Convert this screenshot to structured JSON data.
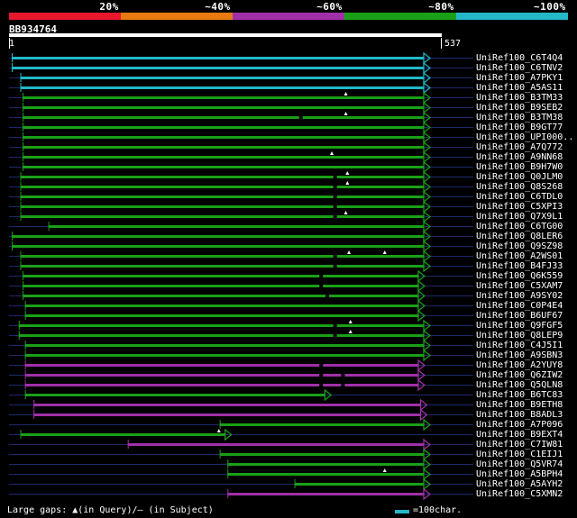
{
  "legend": {
    "colors": [
      "#e8182e",
      "#e87a12",
      "#a030a8",
      "#1aa018",
      "#22b8c8"
    ],
    "labels": [
      "20%",
      "~40%",
      "~60%",
      "~80%",
      "~100%"
    ]
  },
  "query": {
    "title": "BB934764",
    "start": "1",
    "end": "537"
  },
  "hits": [
    {
      "name": "UniRef100_C6T4Q4",
      "color": "#22b8c8",
      "start": 1,
      "end": 537,
      "gaps_q": [],
      "gaps_s": []
    },
    {
      "name": "UniRef100_C6TNV2",
      "color": "#22b8c8",
      "start": 1,
      "end": 537,
      "gaps_q": [],
      "gaps_s": []
    },
    {
      "name": "UniRef100_A7PKY1",
      "color": "#22b8c8",
      "start": 12,
      "end": 537,
      "gaps_q": [],
      "gaps_s": []
    },
    {
      "name": "UniRef100_A5AS11",
      "color": "#22b8c8",
      "start": 12,
      "end": 537,
      "gaps_q": [],
      "gaps_s": []
    },
    {
      "name": "UniRef100_B3TM33",
      "color": "#1aa018",
      "start": 15,
      "end": 537,
      "gaps_q": [
        430
      ],
      "gaps_s": []
    },
    {
      "name": "UniRef100_B9SEB2",
      "color": "#1aa018",
      "start": 15,
      "end": 537,
      "gaps_q": [],
      "gaps_s": []
    },
    {
      "name": "UniRef100_B3TM38",
      "color": "#1aa018",
      "start": 15,
      "end": 537,
      "gaps_q": [
        430
      ],
      "gaps_s": [
        370
      ]
    },
    {
      "name": "UniRef100_B9GT77",
      "color": "#1aa018",
      "start": 15,
      "end": 537,
      "gaps_q": [],
      "gaps_s": []
    },
    {
      "name": "UniRef100_UPI000..",
      "color": "#1aa018",
      "start": 15,
      "end": 537,
      "gaps_q": [],
      "gaps_s": []
    },
    {
      "name": "UniRef100_A7Q772",
      "color": "#1aa018",
      "start": 15,
      "end": 537,
      "gaps_q": [],
      "gaps_s": []
    },
    {
      "name": "UniRef100_A9NN68",
      "color": "#1aa018",
      "start": 15,
      "end": 537,
      "gaps_q": [
        412
      ],
      "gaps_s": []
    },
    {
      "name": "UniRef100_B9H7W0",
      "color": "#1aa018",
      "start": 15,
      "end": 537,
      "gaps_q": [],
      "gaps_s": []
    },
    {
      "name": "UniRef100_Q0JLM0",
      "color": "#1aa018",
      "start": 12,
      "end": 537,
      "gaps_q": [
        432
      ],
      "gaps_s": [
        414
      ]
    },
    {
      "name": "UniRef100_Q8S268",
      "color": "#1aa018",
      "start": 12,
      "end": 537,
      "gaps_q": [
        432
      ],
      "gaps_s": [
        414
      ]
    },
    {
      "name": "UniRef100_C6TDL0",
      "color": "#1aa018",
      "start": 12,
      "end": 537,
      "gaps_q": [],
      "gaps_s": [
        414
      ]
    },
    {
      "name": "UniRef100_C5XPI3",
      "color": "#1aa018",
      "start": 12,
      "end": 537,
      "gaps_q": [],
      "gaps_s": [
        414
      ]
    },
    {
      "name": "UniRef100_Q7X9L1",
      "color": "#1aa018",
      "start": 12,
      "end": 537,
      "gaps_q": [
        430
      ],
      "gaps_s": [
        414
      ]
    },
    {
      "name": "UniRef100_C6TG00",
      "color": "#1aa018",
      "start": 48,
      "end": 537,
      "gaps_q": [],
      "gaps_s": []
    },
    {
      "name": "UniRef100_Q8LER6",
      "color": "#1aa018",
      "start": 1,
      "end": 537,
      "gaps_q": [],
      "gaps_s": []
    },
    {
      "name": "UniRef100_Q9SZ98",
      "color": "#1aa018",
      "start": 1,
      "end": 537,
      "gaps_q": [],
      "gaps_s": []
    },
    {
      "name": "UniRef100_A2WS01",
      "color": "#1aa018",
      "start": 12,
      "end": 537,
      "gaps_q": [
        434,
        480
      ],
      "gaps_s": [
        414
      ]
    },
    {
      "name": "UniRef100_B4FJ33",
      "color": "#1aa018",
      "start": 12,
      "end": 537,
      "gaps_q": [],
      "gaps_s": [
        414
      ]
    },
    {
      "name": "UniRef100_Q6K559",
      "color": "#1aa018",
      "start": 15,
      "end": 530,
      "gaps_q": [],
      "gaps_s": [
        396
      ]
    },
    {
      "name": "UniRef100_C5XAM7",
      "color": "#1aa018",
      "start": 15,
      "end": 530,
      "gaps_q": [],
      "gaps_s": [
        396
      ]
    },
    {
      "name": "UniRef100_A9SY02",
      "color": "#1aa018",
      "start": 15,
      "end": 530,
      "gaps_q": [],
      "gaps_s": [
        404
      ]
    },
    {
      "name": "UniRef100_C0P4E4",
      "color": "#1aa018",
      "start": 18,
      "end": 530,
      "gaps_q": [],
      "gaps_s": []
    },
    {
      "name": "UniRef100_B6UF67",
      "color": "#1aa018",
      "start": 18,
      "end": 530,
      "gaps_q": [],
      "gaps_s": []
    },
    {
      "name": "UniRef100_Q9FGF5",
      "color": "#1aa018",
      "start": 10,
      "end": 537,
      "gaps_q": [
        436
      ],
      "gaps_s": [
        414
      ]
    },
    {
      "name": "UniRef100_Q8LEP9",
      "color": "#1aa018",
      "start": 10,
      "end": 537,
      "gaps_q": [
        436
      ],
      "gaps_s": [
        414
      ]
    },
    {
      "name": "UniRef100_C4J5I1",
      "color": "#1aa018",
      "start": 18,
      "end": 537,
      "gaps_q": [],
      "gaps_s": []
    },
    {
      "name": "UniRef100_A9SBN3",
      "color": "#1aa018",
      "start": 18,
      "end": 537,
      "gaps_q": [],
      "gaps_s": []
    },
    {
      "name": "UniRef100_A2YUY8",
      "color": "#a030a8",
      "start": 18,
      "end": 530,
      "gaps_q": [],
      "gaps_s": [
        396
      ]
    },
    {
      "name": "UniRef100_Q6ZIW2",
      "color": "#a030a8",
      "start": 18,
      "end": 530,
      "gaps_q": [],
      "gaps_s": [
        396,
        424
      ]
    },
    {
      "name": "UniRef100_Q5QLN8",
      "color": "#a030a8",
      "start": 18,
      "end": 530,
      "gaps_q": [],
      "gaps_s": [
        396,
        424
      ]
    },
    {
      "name": "UniRef100_B6TC83",
      "color": "#1aa018",
      "start": 18,
      "end": 410,
      "gaps_q": [],
      "gaps_s": []
    },
    {
      "name": "UniRef100_B9ETH8",
      "color": "#a030a8",
      "start": 29,
      "end": 533,
      "gaps_q": [],
      "gaps_s": []
    },
    {
      "name": "UniRef100_B8ADL3",
      "color": "#a030a8",
      "start": 29,
      "end": 533,
      "gaps_q": [],
      "gaps_s": []
    },
    {
      "name": "UniRef100_A7P096",
      "color": "#1aa018",
      "start": 268,
      "end": 537,
      "gaps_q": [],
      "gaps_s": []
    },
    {
      "name": "UniRef100_B9EXT4",
      "color": "#1aa018",
      "start": 12,
      "end": 282,
      "gaps_q": [
        267
      ],
      "gaps_s": []
    },
    {
      "name": "UniRef100_C7IW81",
      "color": "#a030a8",
      "start": 150,
      "end": 537,
      "gaps_q": [],
      "gaps_s": []
    },
    {
      "name": "UniRef100_C1EIJ1",
      "color": "#1aa018",
      "start": 268,
      "end": 537,
      "gaps_q": [],
      "gaps_s": []
    },
    {
      "name": "UniRef100_Q5VR74",
      "color": "#1aa018",
      "start": 278,
      "end": 537,
      "gaps_q": [],
      "gaps_s": []
    },
    {
      "name": "UniRef100_A5BPH4",
      "color": "#1aa018",
      "start": 278,
      "end": 537,
      "gaps_q": [
        480
      ],
      "gaps_s": []
    },
    {
      "name": "UniRef100_A5AYH2",
      "color": "#1aa018",
      "start": 364,
      "end": 537,
      "gaps_q": [],
      "gaps_s": []
    },
    {
      "name": "UniRef100_C5XMN2",
      "color": "#a030a8",
      "start": 278,
      "end": 537,
      "gaps_q": [],
      "gaps_s": []
    }
  ],
  "footer": {
    "gaps_text": "Large gaps: ▲(in Query)/– (in Subject)",
    "scale_text": "=100char."
  }
}
